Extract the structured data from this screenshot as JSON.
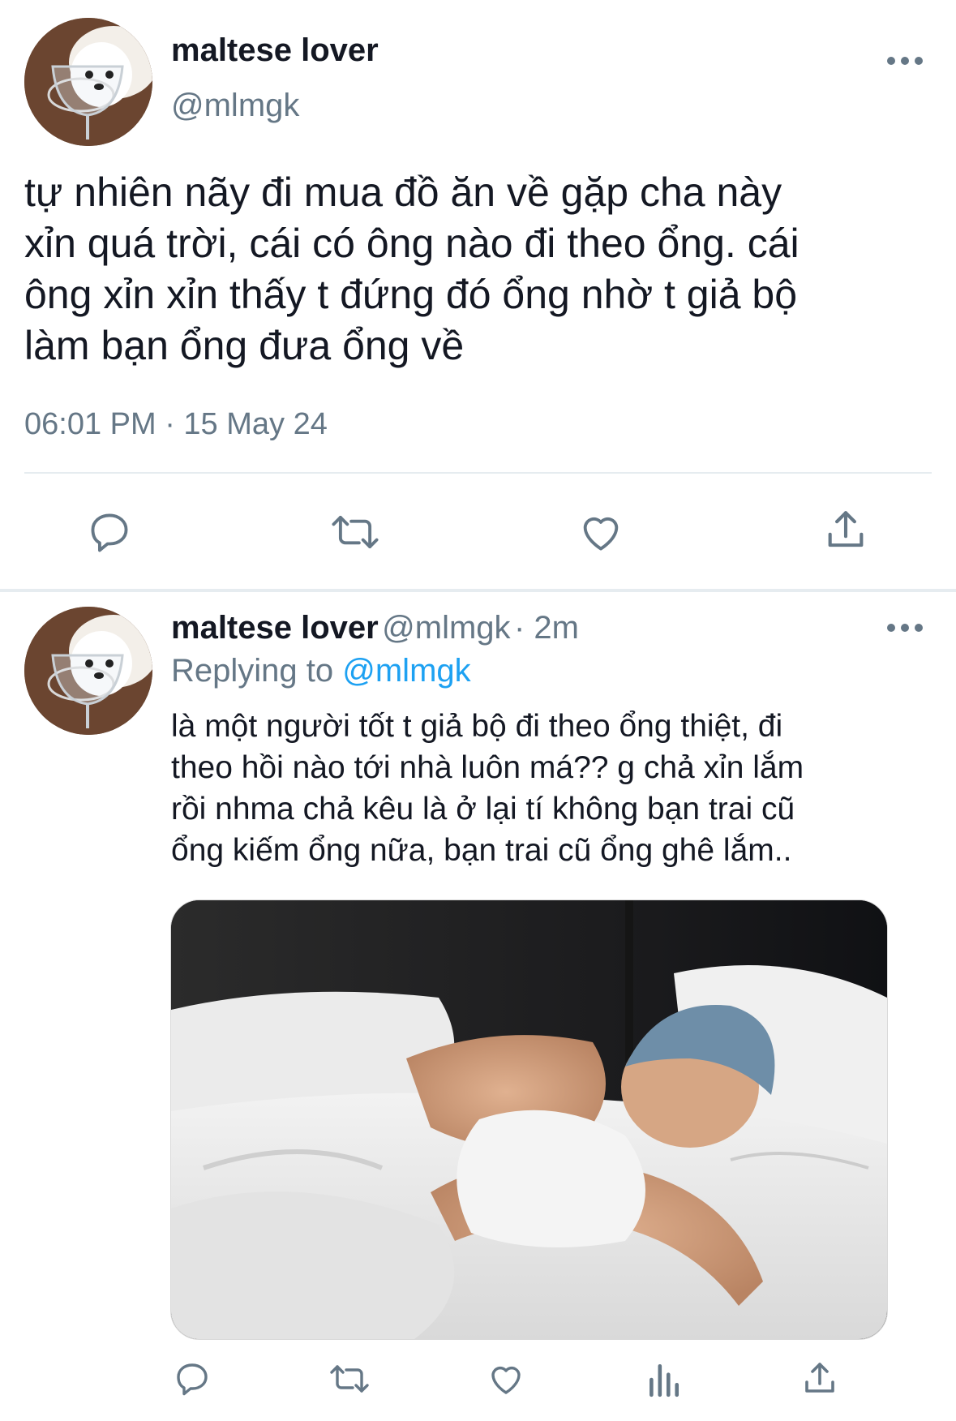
{
  "tweet": {
    "author_name": "maltese lover",
    "author_handle": "@mlmgk",
    "text": "tự nhiên nãy đi mua đồ ăn về gặp cha này\nxỉn quá trời, cái có ông nào đi theo ổng. cái\nông xỉn xỉn thấy t đứng đó ổng nhờ t giả bộ\nlàm bạn ổng đưa ổng về",
    "timestamp": "06:01 PM · 15 May 24"
  },
  "reply": {
    "author_name": "maltese lover",
    "author_handle": "@mlmgk",
    "age": "· 2m",
    "replying_prefix": "Replying to",
    "replying_to": "@mlmgk",
    "text": "là một người tốt t giả bộ đi theo ổng thiệt, đi\ntheo hồi nào tới nhà luôn má?? g chả xỉn lắm\nrồi nhma chả kêu là ở lại tí không bạn trai cũ\nổng kiếm ổng nữa, bạn trai cũ ổng ghê lắm.."
  },
  "colors": {
    "text": "#141823",
    "secondary": "#657786",
    "accent": "#1da1f2",
    "divider": "#e6ecf0"
  },
  "icons": [
    "more-icon",
    "reply-icon",
    "retweet-icon",
    "like-icon",
    "share-icon",
    "analytics-icon"
  ]
}
